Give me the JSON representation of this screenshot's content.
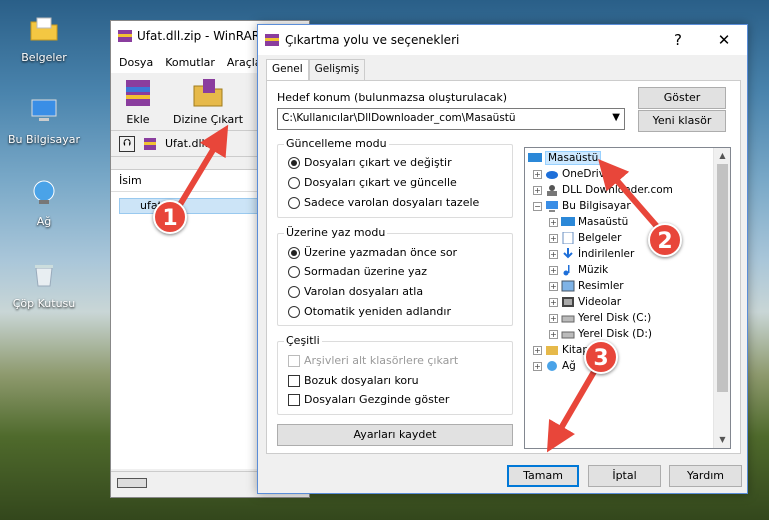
{
  "desktop": {
    "icons": [
      {
        "label": "Belgeler",
        "icon": "folder-icon"
      },
      {
        "label": "Bu Bilgisayar",
        "icon": "computer-icon"
      },
      {
        "label": "Ağ",
        "icon": "network-icon"
      },
      {
        "label": "Çöp Kutusu",
        "icon": "recycle-bin-icon"
      }
    ]
  },
  "winrar": {
    "title": "Ufat.dll.zip - WinRAR",
    "menu": [
      "Dosya",
      "Komutlar",
      "Araçlar"
    ],
    "tools": [
      {
        "label": "Ekle"
      },
      {
        "label": "Dizine Çıkart"
      }
    ],
    "address": "Ufat.dll.zip",
    "column": "İsim",
    "row": "ufat"
  },
  "dialog": {
    "title": "Çıkartma yolu ve seçenekleri",
    "tabs": [
      "Genel",
      "Gelişmiş"
    ],
    "dest_label": "Hedef konum (bulunmazsa oluşturulacak)",
    "dest_path": "C:\\Kullanıcılar\\DllDownloader_com\\Masaüstü",
    "show_btn": "Göster",
    "new_folder_btn": "Yeni klasör",
    "update_group": {
      "title": "Güncelleme modu",
      "options": [
        "Dosyaları çıkart ve değiştir",
        "Dosyaları çıkart ve güncelle",
        "Sadece varolan dosyaları tazele"
      ],
      "selected": 0
    },
    "overwrite_group": {
      "title": "Üzerine yaz modu",
      "options": [
        "Üzerine yazmadan önce sor",
        "Sormadan üzerine yaz",
        "Varolan dosyaları atla",
        "Otomatik yeniden adlandır"
      ],
      "selected": 0
    },
    "misc_group": {
      "title": "Çeşitli",
      "options": [
        "Arşivleri alt klasörlere çıkart",
        "Bozuk dosyaları koru",
        "Dosyaları Gezginde göster"
      ]
    },
    "save_btn": "Ayarları kaydet",
    "tree": [
      "Masaüstü",
      "OneDrive",
      "DLL Downloader.com",
      "Bu Bilgisayar",
      "Masaüstü",
      "Belgeler",
      "İndirilenler",
      "Müzik",
      "Resimler",
      "Videolar",
      "Yerel Disk (C:)",
      "Yerel Disk (D:)",
      "Kitaplıklar",
      "Ağ"
    ],
    "ok_btn": "Tamam",
    "cancel_btn": "İptal",
    "help_btn": "Yardım",
    "help_glyph": "?",
    "close_glyph": "✕"
  },
  "annotations": {
    "steps": [
      "1",
      "2",
      "3"
    ],
    "color": "#e8463a"
  }
}
